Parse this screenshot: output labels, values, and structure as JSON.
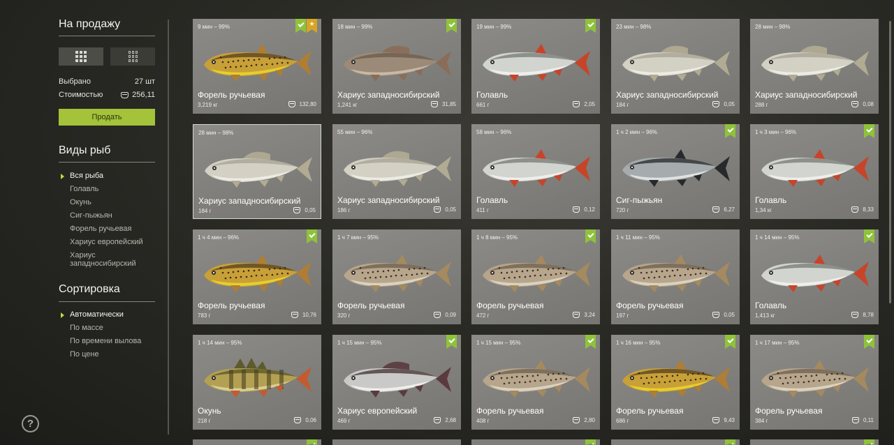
{
  "sidebar": {
    "sale_title": "На продажу",
    "selected_label": "Выбрано",
    "selected_value": "27 шт",
    "cost_label": "Стоимостью",
    "cost_value": "256,11",
    "sell_button": "Продать",
    "species_title": "Виды рыб",
    "species": [
      "Вся рыба",
      "Голавль",
      "Окунь",
      "Сиг-пыжьян",
      "Форель ручьевая",
      "Хариус европейский",
      "Хариус западносибирский"
    ],
    "sort_title": "Сортировка",
    "sort": [
      "Автоматически",
      "По массе",
      "По времени вылова",
      "По цене"
    ],
    "help_icon": "?"
  },
  "colors": {
    "accent": "#a4c23a",
    "badge_check": "#8fc23b",
    "badge_star": "#d6a524"
  },
  "icons": [
    "grid-view-icon",
    "list-view-icon",
    "coin-icon",
    "check-badge-icon",
    "star-badge-icon",
    "help-icon"
  ],
  "cards": [
    {
      "meta": "9 мин – 99%",
      "name": "Форель ручьевая",
      "weight": "3,219 кг",
      "price": "132,80",
      "fish": "trout_yellow",
      "check": true,
      "star": true
    },
    {
      "meta": "18 мин – 99%",
      "name": "Хариус западносибирский",
      "weight": "1,241 кг",
      "price": "31,85",
      "fish": "grayling_brown",
      "check": true
    },
    {
      "meta": "19 мин – 99%",
      "name": "Голавль",
      "weight": "661 г",
      "price": "2,05",
      "fish": "chub",
      "check": true
    },
    {
      "meta": "23 мин – 98%",
      "name": "Хариус западносибирский",
      "weight": "184 г",
      "price": "0,05",
      "fish": "grayling_pale"
    },
    {
      "meta": "28 мин – 98%",
      "name": "Хариус западносибирский",
      "weight": "288 г",
      "price": "0,08",
      "fish": "grayling_pale"
    },
    {
      "meta": "28 мин – 98%",
      "name": "Хариус западносибирский",
      "weight": "184 г",
      "price": "0,05",
      "fish": "grayling_pale",
      "selected": true
    },
    {
      "meta": "55 мин – 96%",
      "name": "Хариус западносибирский",
      "weight": "186 г",
      "price": "0,05",
      "fish": "grayling_pale"
    },
    {
      "meta": "58 мин – 96%",
      "name": "Голавль",
      "weight": "411 г",
      "price": "0,12",
      "fish": "chub"
    },
    {
      "meta": "1 ч 2 мин – 96%",
      "name": "Сиг-пыжьян",
      "weight": "720 г",
      "price": "6,27",
      "fish": "whitefish",
      "check": true
    },
    {
      "meta": "1 ч 3 мин – 96%",
      "name": "Голавль",
      "weight": "1,34 кг",
      "price": "8,33",
      "fish": "chub",
      "check": true
    },
    {
      "meta": "1 ч 4 мин – 96%",
      "name": "Форель ручьевая",
      "weight": "783 г",
      "price": "10,76",
      "fish": "trout_yellow",
      "check": true
    },
    {
      "meta": "1 ч 7 мин – 95%",
      "name": "Форель ручьевая",
      "weight": "320 г",
      "price": "0,09",
      "fish": "trout_brown"
    },
    {
      "meta": "1 ч 8 мин – 95%",
      "name": "Форель ручьевая",
      "weight": "472 г",
      "price": "3,24",
      "fish": "trout_brown",
      "check": true
    },
    {
      "meta": "1 ч 11 мин – 95%",
      "name": "Форель ручьевая",
      "weight": "197 г",
      "price": "0,05",
      "fish": "trout_brown"
    },
    {
      "meta": "1 ч 14 мин – 95%",
      "name": "Голавль",
      "weight": "1,413 кг",
      "price": "8,78",
      "fish": "chub",
      "check": true
    },
    {
      "meta": "1 ч 14 мин – 95%",
      "name": "Окунь",
      "weight": "218 г",
      "price": "0,06",
      "fish": "perch"
    },
    {
      "meta": "1 ч 15 мин – 95%",
      "name": "Хариус европейский",
      "weight": "469 г",
      "price": "2,68",
      "fish": "grayling_euro",
      "check": true
    },
    {
      "meta": "1 ч 15 мин – 95%",
      "name": "Форель ручьевая",
      "weight": "408 г",
      "price": "2,80",
      "fish": "trout_brown",
      "check": true
    },
    {
      "meta": "1 ч 16 мин – 95%",
      "name": "Форель ручьевая",
      "weight": "686 г",
      "price": "9,43",
      "fish": "trout_yellow",
      "check": true
    },
    {
      "meta": "1 ч 17 мин – 95%",
      "name": "Форель ручьевая",
      "weight": "384 г",
      "price": "0,11",
      "fish": "trout_brown",
      "check": true
    }
  ],
  "partial_row_checks": [
    true,
    false,
    true,
    true,
    true
  ]
}
